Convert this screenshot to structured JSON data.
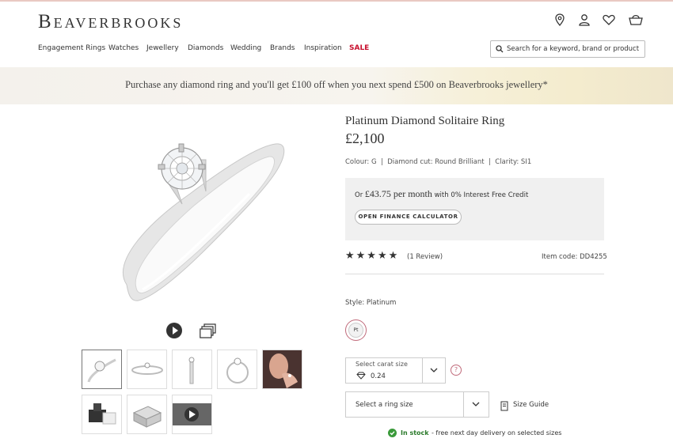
{
  "brand": {
    "logo": "Beaverbrooks"
  },
  "header": {
    "icons": [
      "location-icon",
      "account-icon",
      "wishlist-icon",
      "basket-icon"
    ],
    "nav": [
      "Engagement Rings",
      "Watches",
      "Jewellery",
      "Diamonds",
      "Wedding",
      "Brands",
      "Inspiration",
      "SALE"
    ],
    "search_placeholder": "Search for a keyword, brand or product"
  },
  "banner": {
    "text": "Purchase any diamond ring and you'll get £100 off when you next spend £500 on Beaverbrooks jewellery*"
  },
  "product": {
    "title": "Platinum Diamond Solitaire Ring",
    "price": "£2,100",
    "specs": "Colour: G  |  Diamond cut: Round Brilliant  |  Clarity: SI1",
    "finance": {
      "prefix": "Or ",
      "amount": "£43.75 per month",
      "suffix": " with 0% Interest Free Credit",
      "button": "OPEN FINANCE CALCULATOR"
    },
    "rating": {
      "stars": "★★★★★",
      "value": 5,
      "reviews": "(1 Review)"
    },
    "item_code": "Item code: DD4255",
    "style_label": "Style: Platinum",
    "style_swatch": "Pt",
    "carat": {
      "label": "Select carat size",
      "value": "0.24"
    },
    "help": "?",
    "ring_size": {
      "label": "Select a ring size"
    },
    "size_guide": "Size Guide",
    "stock": {
      "status": "In stock",
      "note": "- free next day delivery on selected sizes"
    }
  },
  "colors": {
    "accent": "#c8102e",
    "swatch_border": "#c06a7a",
    "stock": "#3a9a3a"
  }
}
